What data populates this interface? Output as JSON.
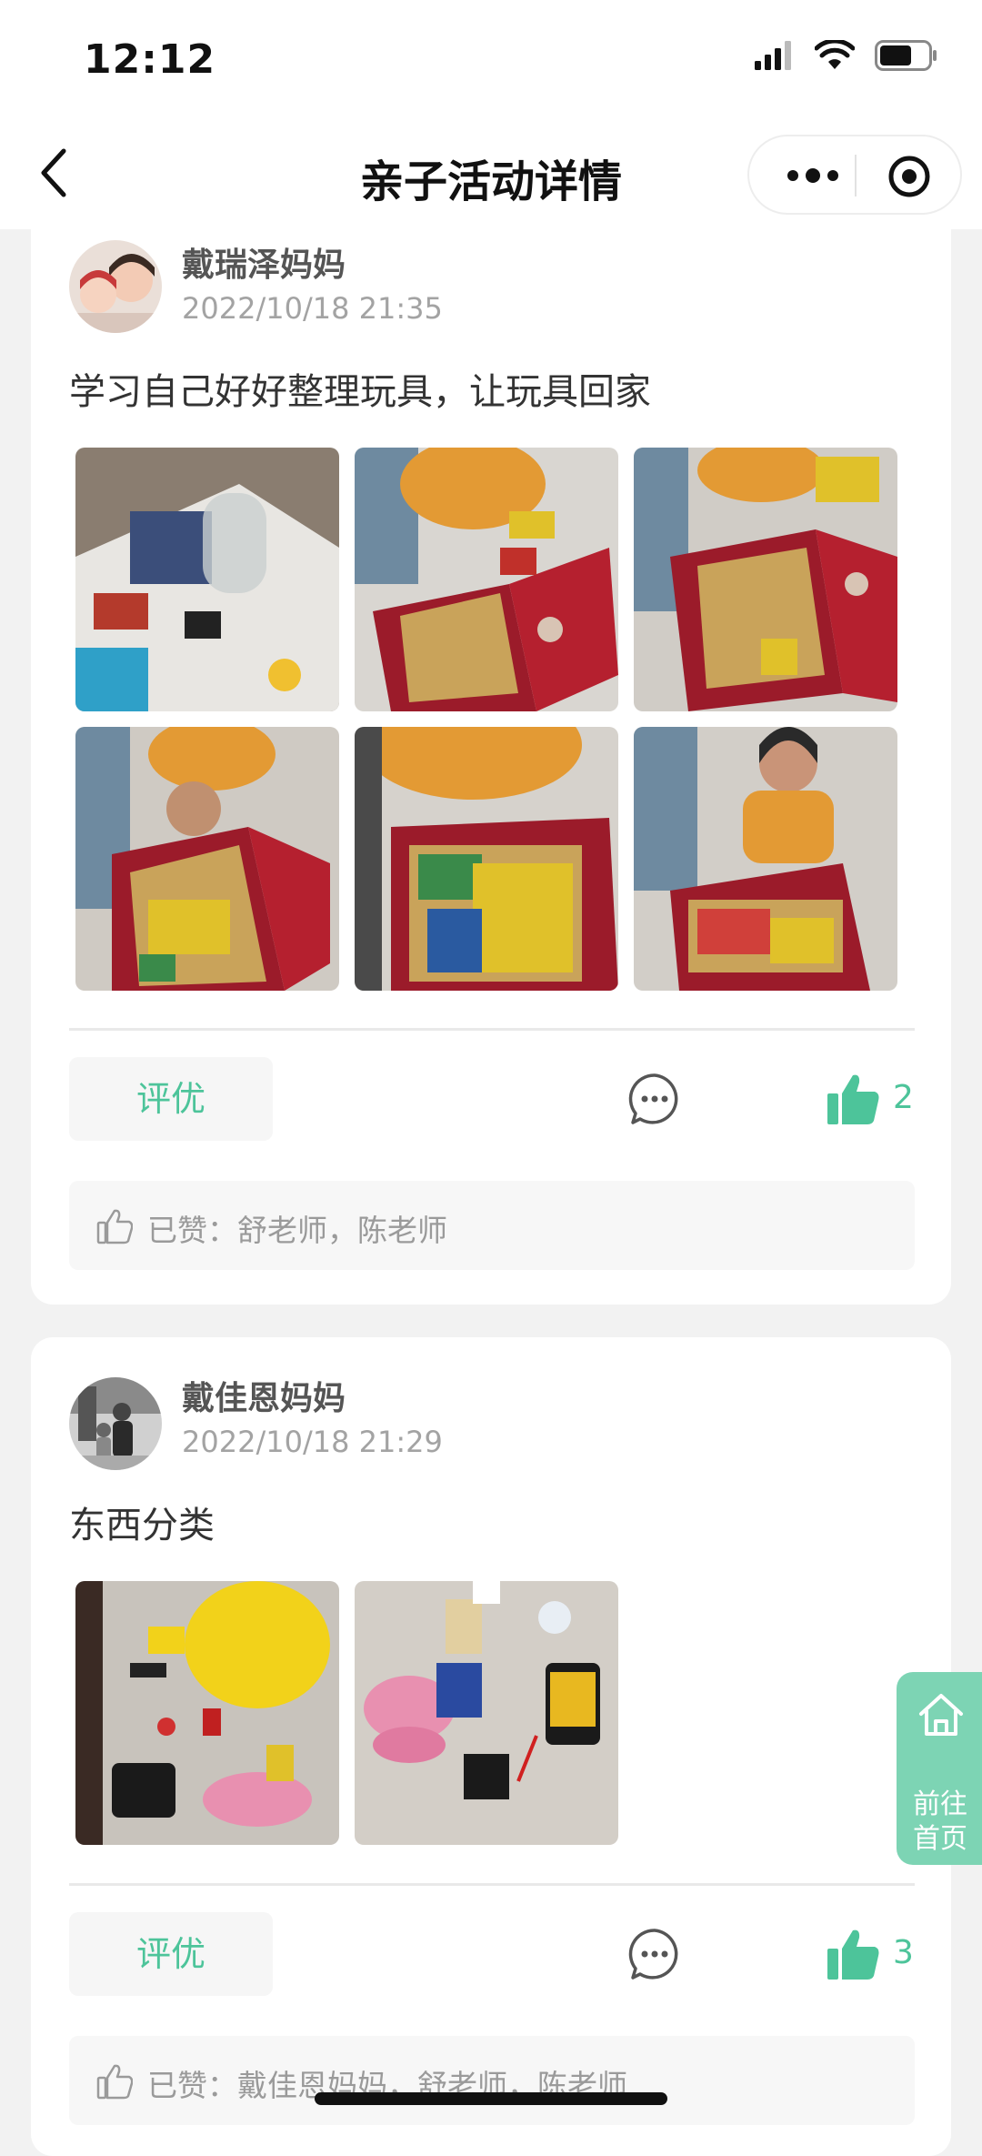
{
  "status_bar": {
    "time": "12:12"
  },
  "nav": {
    "title": "亲子活动详情"
  },
  "posts": [
    {
      "author": "戴瑞泽妈妈",
      "time": "2022/10/18 21:35",
      "text": "学习自己好好整理玩具，让玩具回家",
      "photo_count": 6,
      "rate_label": "评优",
      "like_count": "2",
      "likers": "已赞：舒老师，陈老师"
    },
    {
      "author": "戴佳恩妈妈",
      "time": "2022/10/18 21:29",
      "text": "东西分类",
      "photo_count": 2,
      "rate_label": "评优",
      "like_count": "3",
      "likers": "已赞：戴佳恩妈妈，舒老师，陈老师"
    }
  ],
  "home_button": {
    "line1": "前往",
    "line2": "首页"
  },
  "colors": {
    "accent": "#4dc49a",
    "fab": "#7dd4b4"
  }
}
